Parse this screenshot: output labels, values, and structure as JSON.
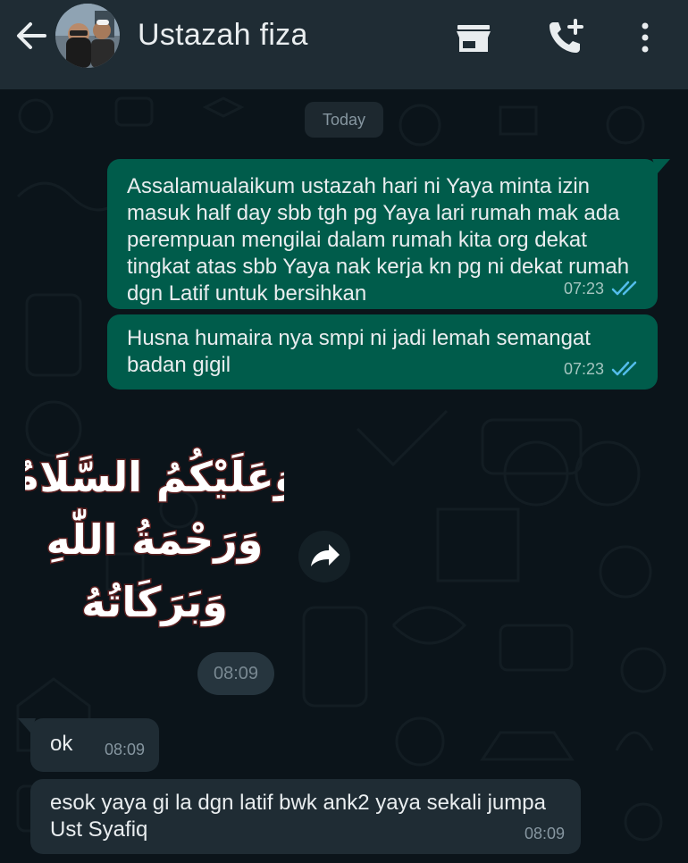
{
  "header": {
    "title": "Ustazah fiza",
    "back_icon": "arrow-left-icon",
    "icons": [
      "store-icon",
      "add-call-icon",
      "more-vert-icon"
    ]
  },
  "chat": {
    "day_label": "Today",
    "messages": [
      {
        "direction": "outgoing",
        "text": "Assalamualaikum ustazah hari ni Yaya minta izin masuk half day sbb tgh pg Yaya lari rumah mak ada perempuan mengilai dalam rumah kita org dekat tingkat atas sbb Yaya nak kerja kn pg ni dekat rumah dgn Latif untuk bersihkan",
        "time": "07:23",
        "status": "read"
      },
      {
        "direction": "outgoing",
        "text": "Husna humaira nya smpi ni jadi lemah semangat badan gigil",
        "time": "07:23",
        "status": "read"
      },
      {
        "direction": "incoming",
        "type": "sticker",
        "sticker_text": [
          "وَعَلَيْكُمُ السَّلَامُ",
          "وَرَحْمَةُ اللّٰهِ",
          "وَبَرَكَاتُهُ"
        ],
        "time": "08:09"
      },
      {
        "direction": "incoming",
        "text": "ok",
        "time": "08:09"
      },
      {
        "direction": "incoming",
        "text": "esok yaya gi la dgn latif bwk ank2 yaya sekali jumpa Ust Syafiq",
        "time": "08:09"
      }
    ]
  },
  "colors": {
    "header_bg": "#1f2c34",
    "chat_bg": "#0b141a",
    "outgoing_bubble": "#005c4b",
    "incoming_bubble": "#1f2c34",
    "read_ticks": "#53bdeb",
    "sticker_fill": "#ffffff",
    "sticker_outline": "#5a1f1f"
  }
}
